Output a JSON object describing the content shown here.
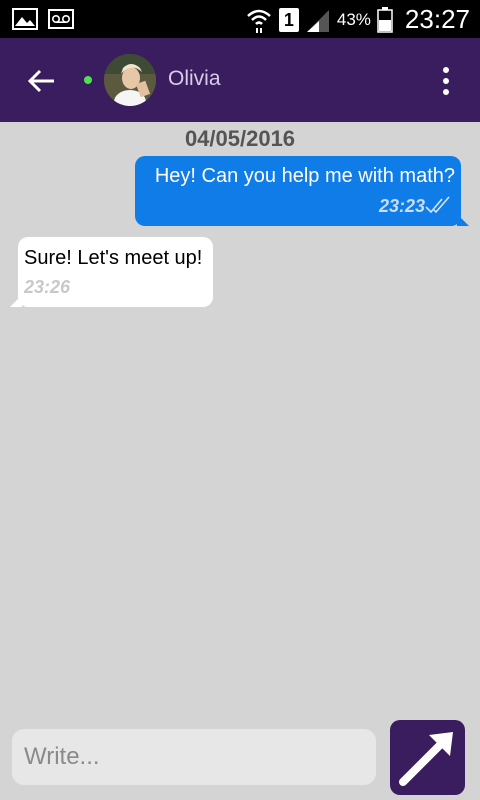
{
  "status_bar": {
    "sim_slot": "1",
    "battery": "43%",
    "time": "23:27",
    "icons": [
      "image-icon",
      "voicemail-icon",
      "wifi-icon",
      "signal-icon",
      "battery-icon"
    ]
  },
  "header": {
    "contact_name": "Olivia",
    "online": true,
    "colors": {
      "bar": "#3a1d5e",
      "online_dot": "#4ee04e"
    }
  },
  "conversation": {
    "date": "04/05/2016",
    "messages": [
      {
        "direction": "outgoing",
        "text": "Hey! Can you help me with math?",
        "time": "23:23",
        "status": "read"
      },
      {
        "direction": "incoming",
        "text": "Sure! Let's meet up!",
        "time": "23:26"
      }
    ],
    "colors": {
      "outgoing_bubble": "#0f7ce8",
      "incoming_bubble": "#ffffff",
      "background": "#d4d4d4"
    }
  },
  "compose": {
    "placeholder": "Write...",
    "value": ""
  }
}
